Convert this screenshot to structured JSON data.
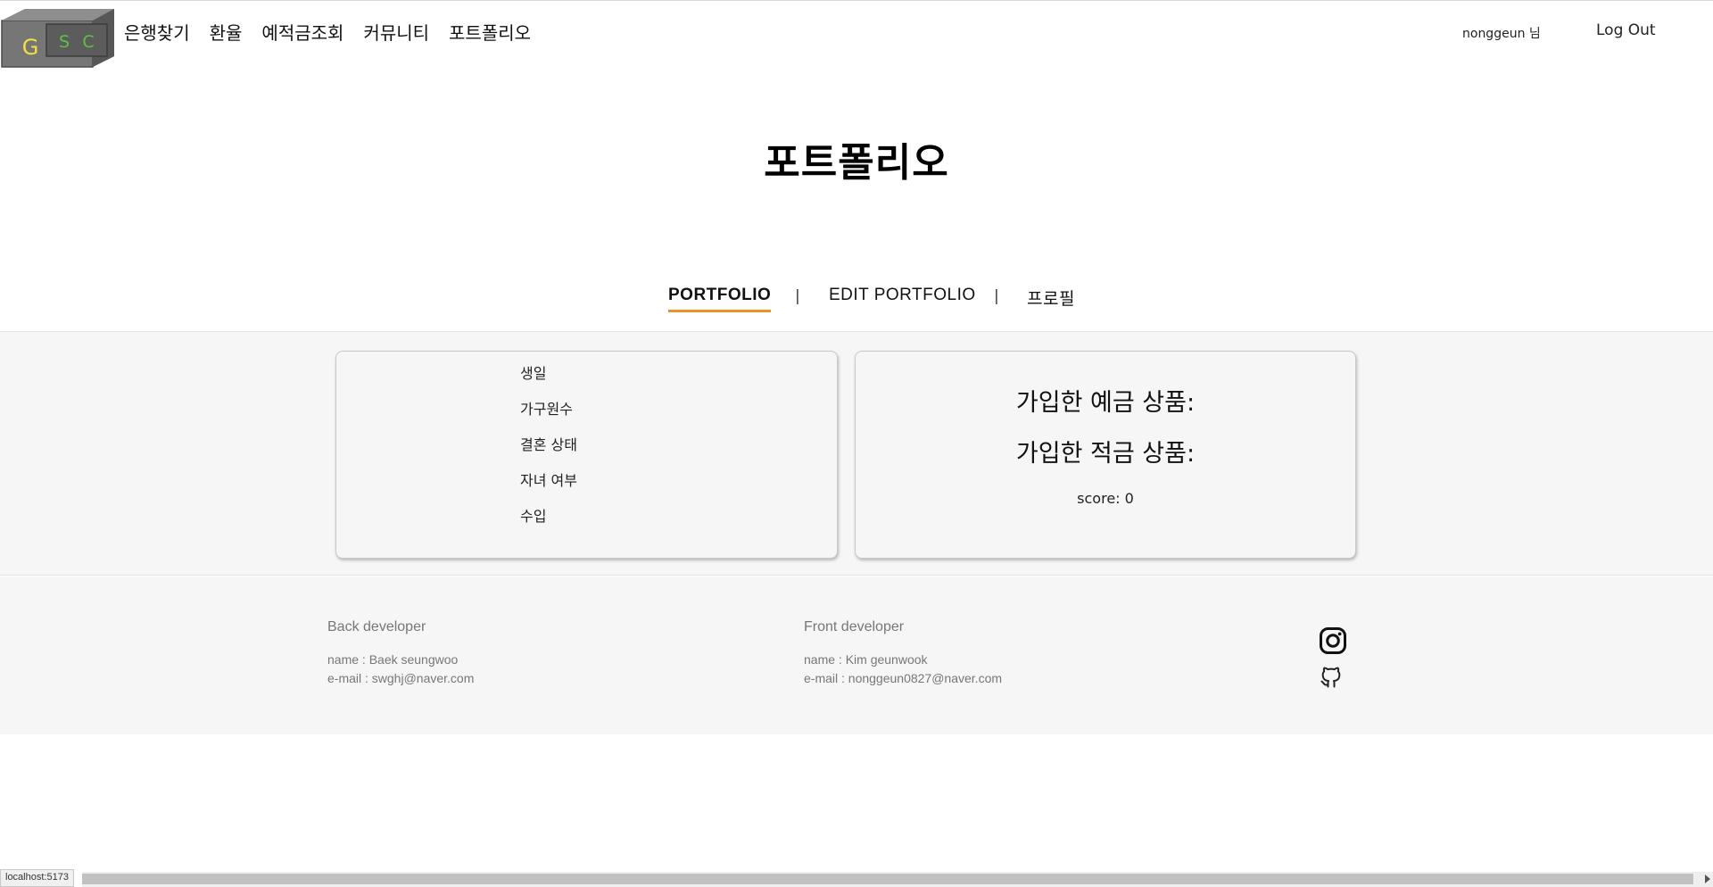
{
  "header": {
    "logo_letters": [
      "G",
      "S",
      "C"
    ],
    "nav": [
      "은행찾기",
      "환율",
      "예적금조회",
      "커뮤니티",
      "포트폴리오"
    ],
    "user_label": "nonggeun 님",
    "logout_label": "Log Out"
  },
  "page": {
    "title": "포트폴리오"
  },
  "tabs": {
    "portfolio": "PORTFOLIO",
    "edit_portfolio": "EDIT PORTFOLIO",
    "profile": "프로필",
    "separator": "|"
  },
  "profile_info": {
    "fields": [
      "생일",
      "가구원수",
      "결혼 상태",
      "자녀 여부",
      "수입"
    ]
  },
  "subscriptions": {
    "deposit_label": "가입한 예금 상품:",
    "savings_label": "가입한 적금 상품:",
    "score_text": "score: 0"
  },
  "footer": {
    "back": {
      "heading": "Back developer",
      "name": "name  : Baek seungwoo",
      "email": "e-mail : swghj@naver.com"
    },
    "front": {
      "heading": "Front developer",
      "name": "name  : Kim geunwook",
      "email": "e-mail : nonggeun0827@naver.com"
    },
    "social_icons": [
      "instagram-icon",
      "github-icon"
    ]
  },
  "statusbar": {
    "url": "localhost:5173"
  },
  "colors": {
    "tab_underline": "#ef8f32",
    "band_background": "#f6f6f6",
    "logo_yellow": "#f1e13a",
    "logo_green": "#5ec23f"
  }
}
